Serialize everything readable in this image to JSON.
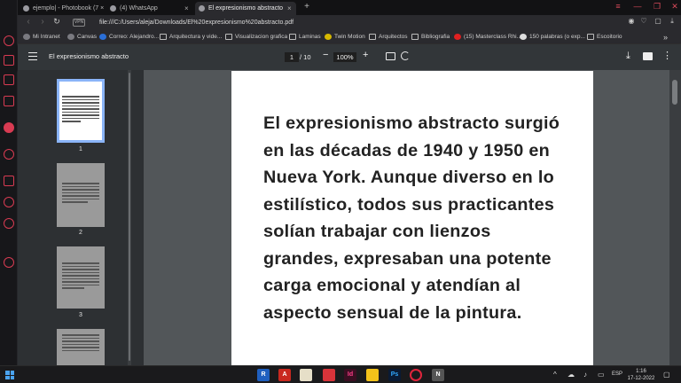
{
  "browser": {
    "tabs": [
      {
        "label": "ejemplo| - Photobook (7 ×",
        "close": ""
      },
      {
        "label": "(4) WhatsApp",
        "close": "×"
      },
      {
        "label": "El expresionismo abstracto",
        "close": "×"
      }
    ],
    "new_tab": "+",
    "window_controls": [
      "≡",
      "—",
      "❐",
      "✕"
    ],
    "vpn_label": "VPN",
    "url": "file:///C:/Users/aleja/Downloads/El%20expresionismo%20abstracto.pdf"
  },
  "bookmarks": [
    "Mi Intranet",
    "Canvas",
    "Correo: Alejandro...",
    "Arquitectura y vide...",
    "Visualizacion grafica",
    "Laminas",
    "Twin Motion",
    "Arquitectos",
    "Bibliografia",
    "(15) Masterclass Rhi...",
    "150 palabras (o exp...",
    "Escoitorio"
  ],
  "bookmarks_more": "»",
  "pdf_viewer": {
    "title": "El expresionismo abstracto",
    "current_page": "1",
    "total_pages": "/ 10",
    "zoom": "100%",
    "zoom_out": "−",
    "zoom_in": "+",
    "more": "⋮",
    "download": "⤓",
    "thumbnails": [
      {
        "number": "1",
        "selected": true
      },
      {
        "number": "2",
        "selected": false
      },
      {
        "number": "3",
        "selected": false
      },
      {
        "number": "",
        "selected": false
      }
    ],
    "page_text": "El expresionismo abstracto surgió en las décadas de 1940 y 1950 en Nueva York. Aunque diverso en lo estilístico, todos sus practicantes solían trabajar con lienzos grandes, expresaban una potente carga emocional y atendían al aspecto sensual de la pintura."
  },
  "taskbar": {
    "apps": [
      "R",
      "A",
      "",
      "",
      "Id",
      "",
      "Ps",
      "",
      "N"
    ],
    "tray_arrow": "^",
    "language": "ESP",
    "time": "1:16",
    "date": "17-12-2022"
  },
  "colors": {
    "accent": "#d83b52",
    "pdf_toolbar": "#323639",
    "viewer_bg": "#525659"
  }
}
